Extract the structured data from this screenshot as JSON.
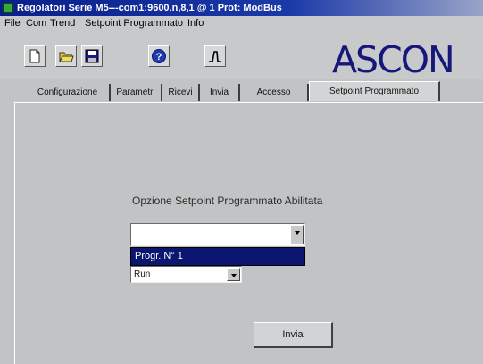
{
  "window": {
    "title": "Regolatori Serie M5---com1:9600,n,8,1 @ 1 Prot: ModBus"
  },
  "menu": [
    "File",
    "Com",
    "Trend",
    "Setpoint Programmato",
    "Info"
  ],
  "toolbar": {
    "buttons": [
      "new-file-icon",
      "open-folder-icon",
      "save-disk-icon",
      "help-icon",
      "setpoint-profile-icon"
    ],
    "logo": "ASCON"
  },
  "tabs": [
    {
      "label": "Configurazione",
      "active": false
    },
    {
      "label": "Parametri",
      "active": false
    },
    {
      "label": "Ricevi",
      "active": false
    },
    {
      "label": "Invia",
      "active": false
    },
    {
      "label": "Accesso",
      "active": false
    },
    {
      "label": "Setpoint Programmato",
      "active": true
    }
  ],
  "panel": {
    "option_label": "Opzione Setpoint Programmato Abilitata",
    "program_combo": {
      "value": "",
      "dropdown_option": "Progr. N° 1"
    },
    "mode_combo": {
      "value": "Run"
    },
    "send_button": "Invia"
  },
  "colors": {
    "title_bar": "#0a1f8c",
    "selection": "#0b1670",
    "logo": "#16177a",
    "background": "#c2c3c4"
  }
}
